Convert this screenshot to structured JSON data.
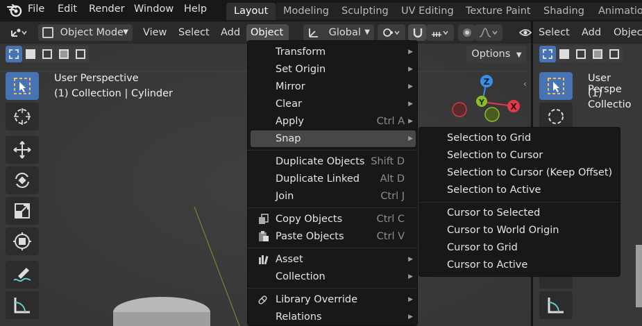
{
  "topbar": {
    "menus": [
      "File",
      "Edit",
      "Render",
      "Window",
      "Help"
    ],
    "workspaces": [
      "Layout",
      "Modeling",
      "Sculpting",
      "UV Editing",
      "Texture Paint",
      "Shading",
      "Animation"
    ],
    "active_workspace": "Layout"
  },
  "header": {
    "mode": "Object Mode",
    "view": "View",
    "select": "Select",
    "add": "Add",
    "object": "Object",
    "orientation": "Global",
    "options": "Options",
    "right_select": "Select",
    "right_add": "Add",
    "right_object": "Object"
  },
  "viewport": {
    "perspective": "User Perspective",
    "collection": "(1) Collection | Cylinder",
    "perspective_right": "User Perspe",
    "collection_right": "(1) Collectio",
    "gizmo_z": "Z",
    "gizmo_y": "Y",
    "gizmo_x": "X"
  },
  "object_menu": {
    "items": [
      {
        "label": "Transform",
        "shortcut": "",
        "submenu": true
      },
      {
        "label": "Set Origin",
        "shortcut": "",
        "submenu": true
      },
      {
        "label": "Mirror",
        "shortcut": "",
        "submenu": true
      },
      {
        "label": "Clear",
        "shortcut": "",
        "submenu": true
      },
      {
        "label": "Apply",
        "shortcut": "Ctrl A",
        "submenu": true
      },
      {
        "label": "Snap",
        "shortcut": "",
        "submenu": true
      },
      {
        "label": "Duplicate Objects",
        "shortcut": "Shift D",
        "submenu": false
      },
      {
        "label": "Duplicate Linked",
        "shortcut": "Alt D",
        "submenu": false
      },
      {
        "label": "Join",
        "shortcut": "Ctrl J",
        "submenu": false
      },
      {
        "label": "Copy Objects",
        "shortcut": "Ctrl C",
        "submenu": false
      },
      {
        "label": "Paste Objects",
        "shortcut": "Ctrl V",
        "submenu": false
      },
      {
        "label": "Asset",
        "shortcut": "",
        "submenu": true
      },
      {
        "label": "Collection",
        "shortcut": "",
        "submenu": true
      },
      {
        "label": "Library Override",
        "shortcut": "",
        "submenu": true
      },
      {
        "label": "Relations",
        "shortcut": "",
        "submenu": true
      }
    ],
    "highlighted": "Snap"
  },
  "snap_submenu": {
    "items": [
      "Selection to Grid",
      "Selection to Cursor",
      "Selection to Cursor (Keep Offset)",
      "Selection to Active",
      "Cursor to Selected",
      "Cursor to World Origin",
      "Cursor to Grid",
      "Cursor to Active"
    ]
  },
  "colors": {
    "accent": "#4772b3",
    "menu_bg": "#181818",
    "highlight": "#474747",
    "axis_x": "#e0394a",
    "axis_y": "#8bbd21",
    "axis_z": "#3a8ee6"
  }
}
